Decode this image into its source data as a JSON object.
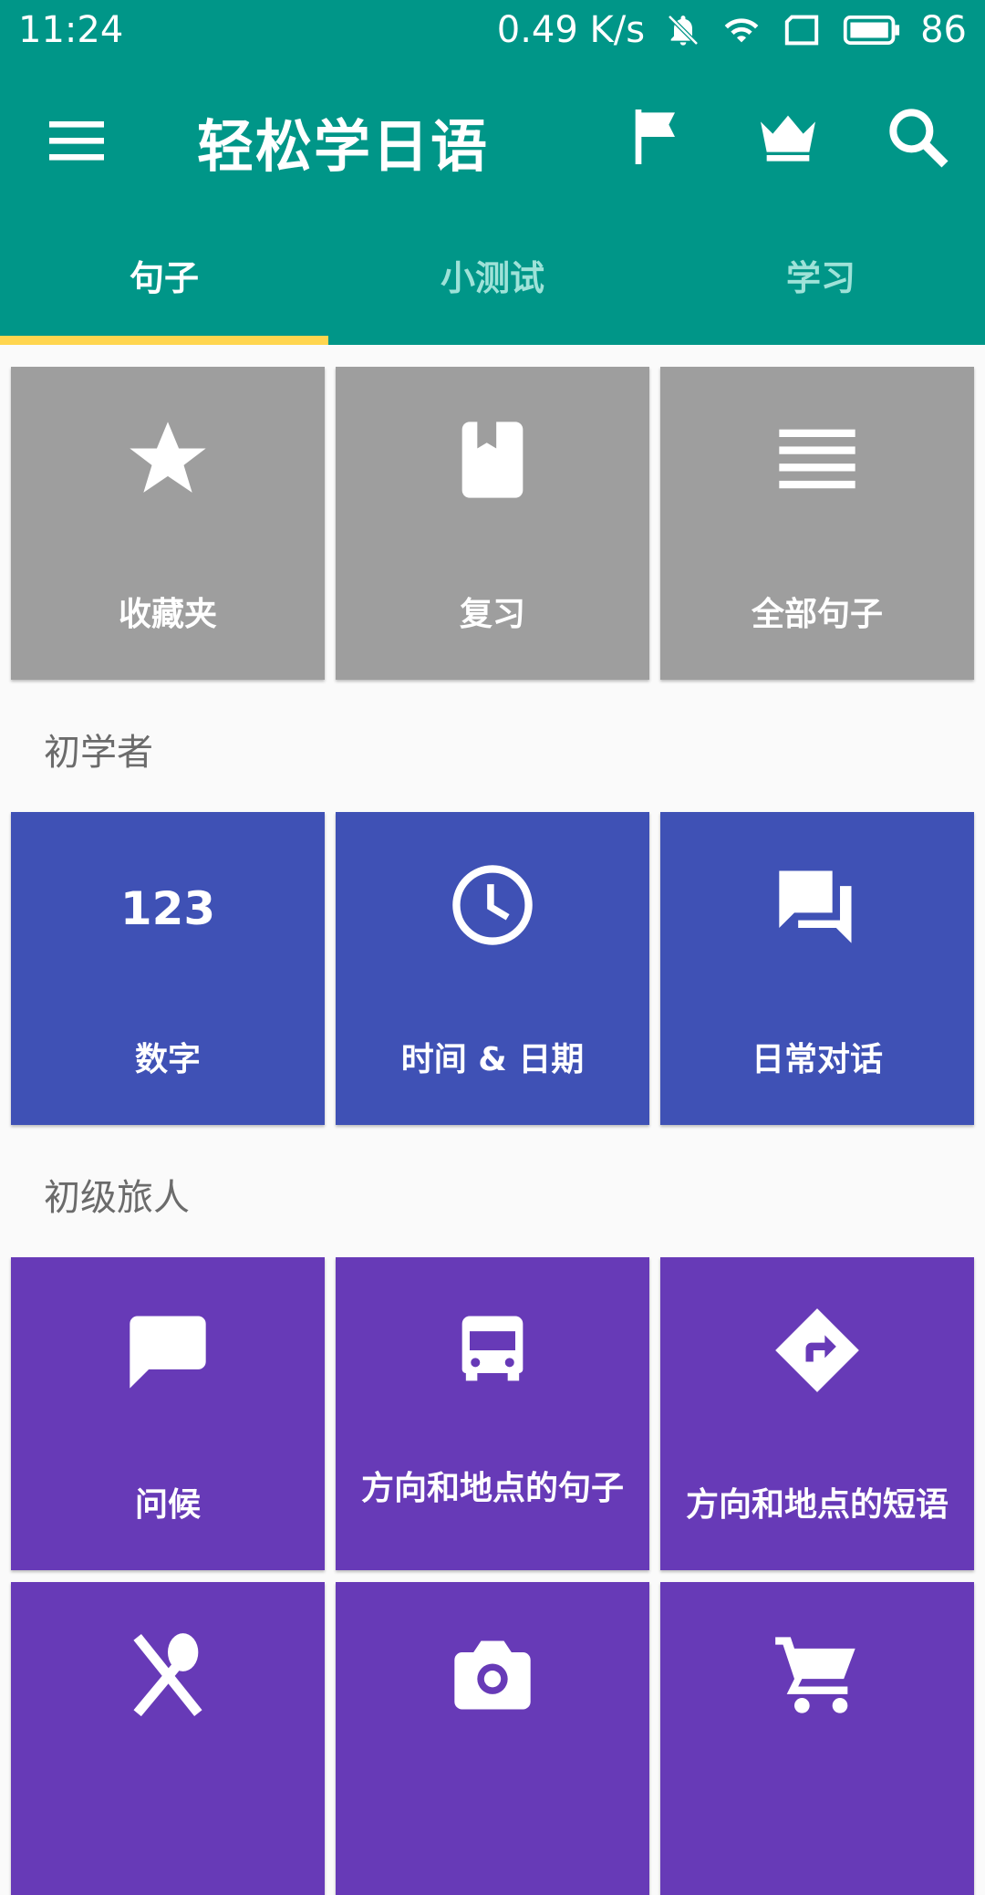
{
  "status": {
    "time": "11:24",
    "speed": "0.49 K/s",
    "battery": "86"
  },
  "toolbar": {
    "title": "轻松学日语",
    "icons": [
      "menu-icon",
      "flag-icon",
      "crown-icon",
      "search-icon"
    ]
  },
  "tabs": [
    {
      "label": "句子",
      "active": true
    },
    {
      "label": "小测试",
      "active": false
    },
    {
      "label": "学习",
      "active": false
    }
  ],
  "top_tiles": [
    {
      "label": "收藏夹",
      "icon": "star-icon"
    },
    {
      "label": "复习",
      "icon": "book-icon"
    },
    {
      "label": "全部句子",
      "icon": "list-icon"
    }
  ],
  "sections": [
    {
      "title": "初学者",
      "tiles": [
        {
          "label": "数字",
          "icon": "numbers-123-icon"
        },
        {
          "label": "时间 & 日期",
          "icon": "clock-icon"
        },
        {
          "label": "日常对话",
          "icon": "chat-bubbles-icon"
        }
      ]
    },
    {
      "title": "初级旅人",
      "tiles": [
        {
          "label": "问候",
          "icon": "speech-bubble-icon"
        },
        {
          "label": "方向和地点的句子",
          "icon": "bus-icon"
        },
        {
          "label": "方向和地点的短语",
          "icon": "direction-sign-icon"
        }
      ]
    }
  ],
  "bottom_tiles": [
    {
      "icon": "utensils-icon"
    },
    {
      "icon": "camera-icon"
    },
    {
      "icon": "cart-icon"
    }
  ],
  "colors": {
    "primary": "#009688",
    "tab_indicator": "#ffd54f",
    "grey_tile": "#9e9e9e",
    "blue_tile": "#3f51b5",
    "purple_tile": "#673ab7"
  }
}
